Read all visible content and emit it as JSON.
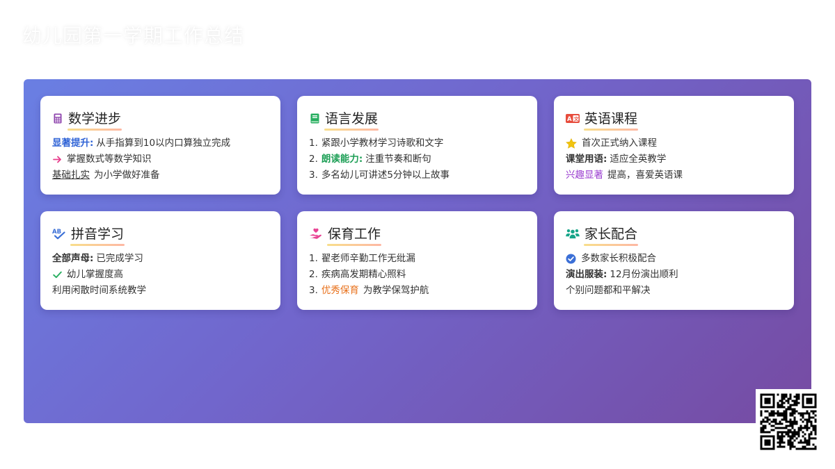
{
  "page": {
    "title": "幼儿园第一学期工作总结"
  },
  "cards": [
    {
      "title": "数学进步",
      "icon": "calculator-icon",
      "lines": [
        {
          "label": "显著提升:",
          "text": "从手指算到10以内口算独立完成"
        },
        {
          "text": "掌握数式等数学知识"
        },
        {
          "highlight": "基础扎实",
          "text": "为小学做好准备"
        }
      ]
    },
    {
      "title": "语言发展",
      "icon": "book-icon",
      "lines": [
        {
          "num": "1.",
          "text": "紧跟小学教材学习诗歌和文字"
        },
        {
          "num": "2.",
          "label": "朗读能力:",
          "text": "注重节奏和断句"
        },
        {
          "num": "3.",
          "text": "多名幼儿可讲述5分钟以上故事"
        }
      ]
    },
    {
      "title": "英语课程",
      "icon": "language-icon",
      "lines": [
        {
          "text": "首次正式纳入课程"
        },
        {
          "label": "课堂用语:",
          "text": "适应全英教学"
        },
        {
          "highlight": "兴趣显著",
          "text": "提高，喜爱英语课"
        }
      ]
    },
    {
      "title": "拼音学习",
      "icon": "spell-check-icon",
      "lines": [
        {
          "label": "全部声母:",
          "text": "已完成学习"
        },
        {
          "text": "幼儿掌握度高"
        },
        {
          "text": "利用闲散时间系统教学"
        }
      ]
    },
    {
      "title": "保育工作",
      "icon": "hand-heart-icon",
      "lines": [
        {
          "num": "1.",
          "text": "翟老师辛勤工作无纰漏"
        },
        {
          "num": "2.",
          "text": "疾病高发期精心照料"
        },
        {
          "num": "3.",
          "highlight": "优秀保育",
          "text": "为教学保驾护航"
        }
      ]
    },
    {
      "title": "家长配合",
      "icon": "users-icon",
      "lines": [
        {
          "text": "多数家长积极配合"
        },
        {
          "label": "演出服装:",
          "text": "12月份演出顺利"
        },
        {
          "text": "个别问题都和平解决"
        }
      ]
    }
  ],
  "colors": {
    "gradient_start": "#667eea",
    "gradient_end": "#764ba2",
    "accent_blue": "#2f63d6",
    "accent_green": "#1d9f56",
    "accent_orange": "#e8701a",
    "accent_purple": "#9b3fd0"
  }
}
